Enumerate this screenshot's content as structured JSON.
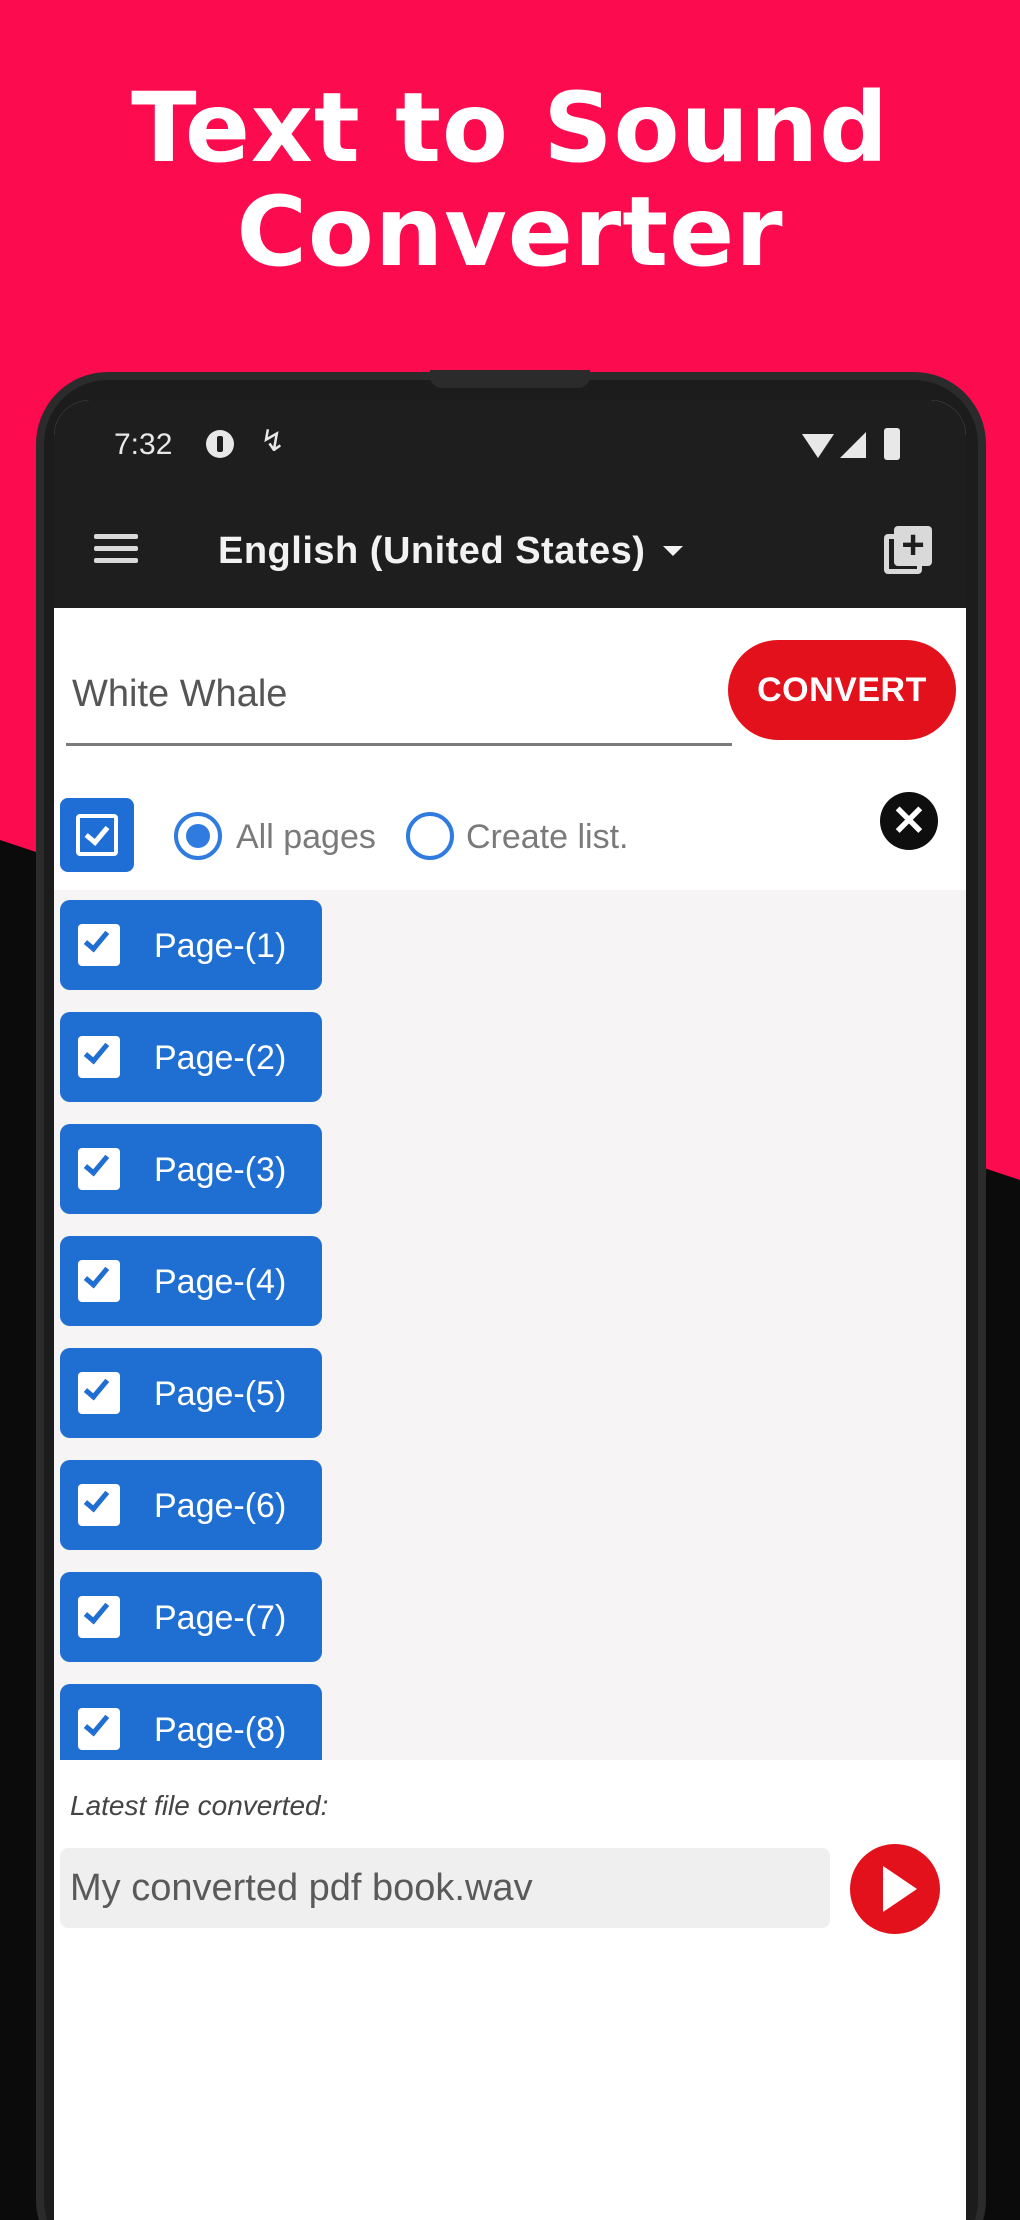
{
  "promo": {
    "headline_line1": "Text to Sound",
    "headline_line2": "Converter"
  },
  "statusbar": {
    "time": "7:32",
    "icon_b": "↯"
  },
  "appbar": {
    "language": "English (United States)"
  },
  "editor": {
    "text_value": "White Whale",
    "convert_label": "CONVERT"
  },
  "selection": {
    "all_pages_label": "All pages",
    "create_list_label": "Create list.",
    "close_glyph": "✕",
    "selected_option": "All pages"
  },
  "pages": [
    {
      "label": "Page-(1)",
      "checked": true
    },
    {
      "label": "Page-(2)",
      "checked": true
    },
    {
      "label": "Page-(3)",
      "checked": true
    },
    {
      "label": "Page-(4)",
      "checked": true
    },
    {
      "label": "Page-(5)",
      "checked": true
    },
    {
      "label": "Page-(6)",
      "checked": true
    },
    {
      "label": "Page-(7)",
      "checked": true
    },
    {
      "label": "Page-(8)",
      "checked": true
    }
  ],
  "latest": {
    "label": "Latest file converted:",
    "file_name": "My converted pdf book.wav"
  },
  "colors": {
    "brand_pink": "#fc0b4f",
    "accent_red": "#e3111b",
    "page_blue": "#1f6fd3"
  }
}
